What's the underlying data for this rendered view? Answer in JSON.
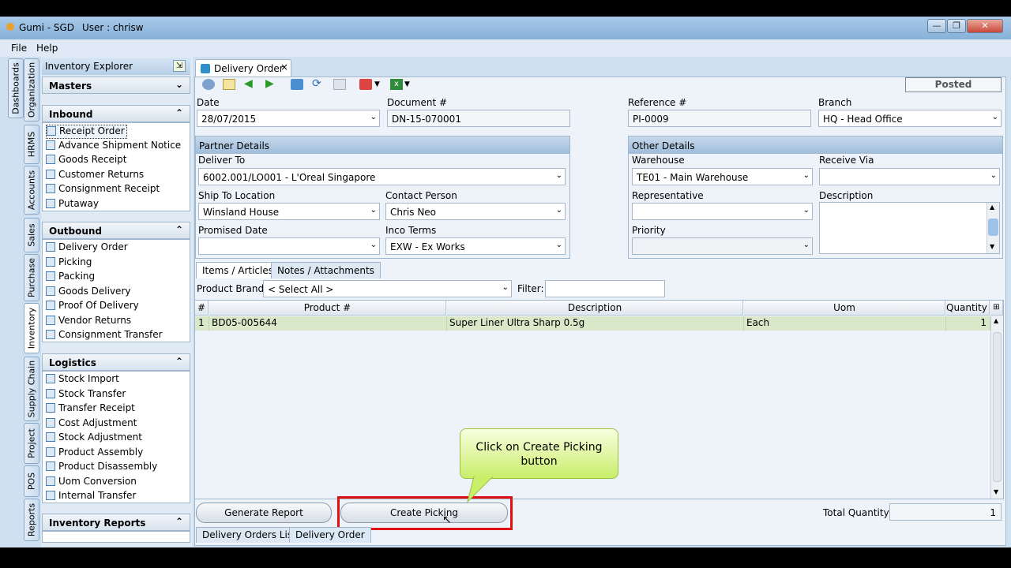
{
  "window": {
    "app": "Gumi - SGD",
    "user": "User : chrisw"
  },
  "menu": [
    "File",
    "Help"
  ],
  "vertical_tabs": [
    "Dashboards",
    "Organization",
    "HRMS",
    "Accounts",
    "Sales",
    "Purchase",
    "Inventory",
    "Supply Chain",
    "Project",
    "POS",
    "Reports"
  ],
  "explorer": {
    "title": "Inventory Explorer",
    "masters": "Masters",
    "inbound": {
      "title": "Inbound",
      "items": [
        "Receipt Order",
        "Advance Shipment Notice",
        "Goods Receipt",
        "Customer Returns",
        "Consignment Receipt",
        "Putaway"
      ]
    },
    "outbound": {
      "title": "Outbound",
      "items": [
        "Delivery Order",
        "Picking",
        "Packing",
        "Goods Delivery",
        "Proof Of Delivery",
        "Vendor Returns",
        "Consignment Transfer"
      ]
    },
    "logistics": {
      "title": "Logistics",
      "items": [
        "Stock Import",
        "Stock Transfer",
        "Transfer Receipt",
        "Cost Adjustment",
        "Stock Adjustment",
        "Product Assembly",
        "Product Disassembly",
        "Uom Conversion",
        "Internal Transfer"
      ]
    },
    "reports": "Inventory Reports"
  },
  "doc_tab": {
    "label": "Delivery Order",
    "close": "×"
  },
  "status": "Posted",
  "form": {
    "date_label": "Date",
    "date": "28/07/2015",
    "document_label": "Document #",
    "document": "DN-15-070001",
    "reference_label": "Reference #",
    "reference": "PI-0009",
    "branch_label": "Branch",
    "branch": "HQ - Head Office"
  },
  "partner": {
    "title": "Partner Details",
    "deliver_to_label": "Deliver To",
    "deliver_to": "6002.001/LO001 - L'Oreal Singapore",
    "ship_to_label": "Ship To Location",
    "ship_to": "Winsland House",
    "contact_label": "Contact Person",
    "contact": "Chris Neo",
    "promised_label": "Promised Date",
    "promised": "",
    "inco_label": "Inco Terms",
    "inco": "EXW - Ex Works"
  },
  "other": {
    "title": "Other Details",
    "warehouse_label": "Warehouse",
    "warehouse": "TE01 - Main Warehouse",
    "receive_label": "Receive Via",
    "receive": "",
    "rep_label": "Representative",
    "rep": "",
    "desc_label": "Description",
    "priority_label": "Priority",
    "priority": ""
  },
  "item_tabs": [
    "Items / Articles",
    "Notes / Attachments"
  ],
  "filters": {
    "brand_label": "Product Brand:",
    "brand": "< Select All >",
    "filter_label": "Filter:",
    "filter": ""
  },
  "grid": {
    "columns": [
      "#",
      "Product #",
      "Description",
      "Uom",
      "Quantity"
    ],
    "rows": [
      {
        "n": "1",
        "product": "BD05-005644",
        "description": "Super Liner Ultra Sharp 0.5g",
        "uom": "Each",
        "qty": "1"
      }
    ]
  },
  "buttons": {
    "generate": "Generate Report",
    "create_picking": "Create Picking"
  },
  "total": {
    "label": "Total Quantity:",
    "value": "1"
  },
  "bottom_tabs": [
    "Delivery Orders List",
    "Delivery Order"
  ],
  "callout": "Click on Create Picking button",
  "colors": {
    "highlight": "#e01010",
    "callout": "#c9ee6a",
    "selected_row": "#d9e8c9"
  }
}
